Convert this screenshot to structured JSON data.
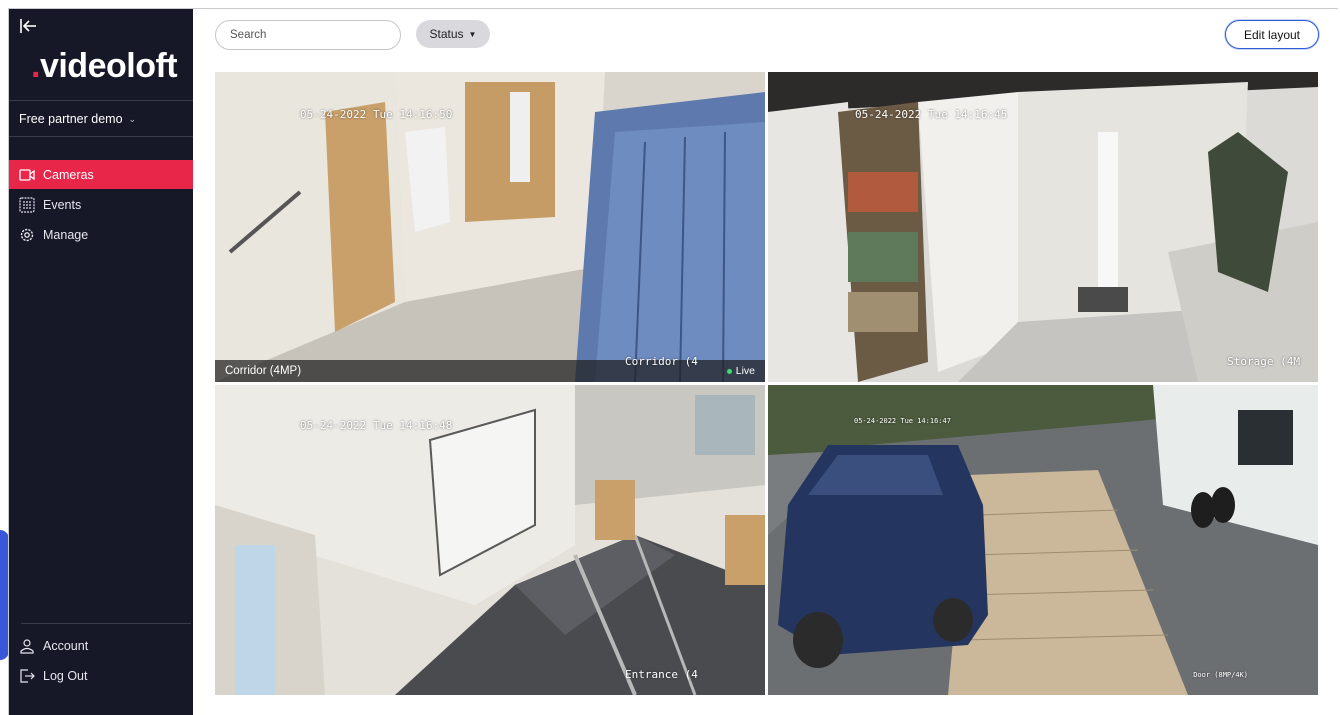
{
  "app": {
    "logo_text": "videoloft",
    "logo_dot": ".",
    "organization": "Free partner demo"
  },
  "nav": {
    "items": [
      {
        "label": "Cameras",
        "icon": "camera-icon",
        "active": true
      },
      {
        "label": "Events",
        "icon": "events-grid-icon",
        "active": false
      },
      {
        "label": "Manage",
        "icon": "gear-icon",
        "active": false
      }
    ],
    "bottom": [
      {
        "label": "Account",
        "icon": "user-icon"
      },
      {
        "label": "Log Out",
        "icon": "logout-icon"
      }
    ]
  },
  "toolbar": {
    "search_placeholder": "Search",
    "status_label": "Status",
    "edit_layout_label": "Edit layout"
  },
  "cameras": [
    {
      "name": "Corridor (4MP)",
      "timestamp": "05-24-2022 Tue 14:16:50",
      "overlay_name": "Corridor (4",
      "live_label": "Live"
    },
    {
      "name": "Storage (4M",
      "timestamp": "05-24-2022 Tue 14:16:45",
      "overlay_name": "Storage (4M"
    },
    {
      "name": "Entrance (4",
      "timestamp": "05-24-2022 Tue 14:16:48",
      "overlay_name": "Entrance (4"
    },
    {
      "name": "Door (8MP/4K)",
      "timestamp": "05-24-2022 Tue 14:16:47",
      "overlay_name": "Door (8MP/4K)"
    }
  ],
  "colors": {
    "sidebar_bg": "#161727",
    "accent": "#e8264a",
    "edit_border": "#2e5bd6",
    "live_dot": "#3ddc6c"
  }
}
